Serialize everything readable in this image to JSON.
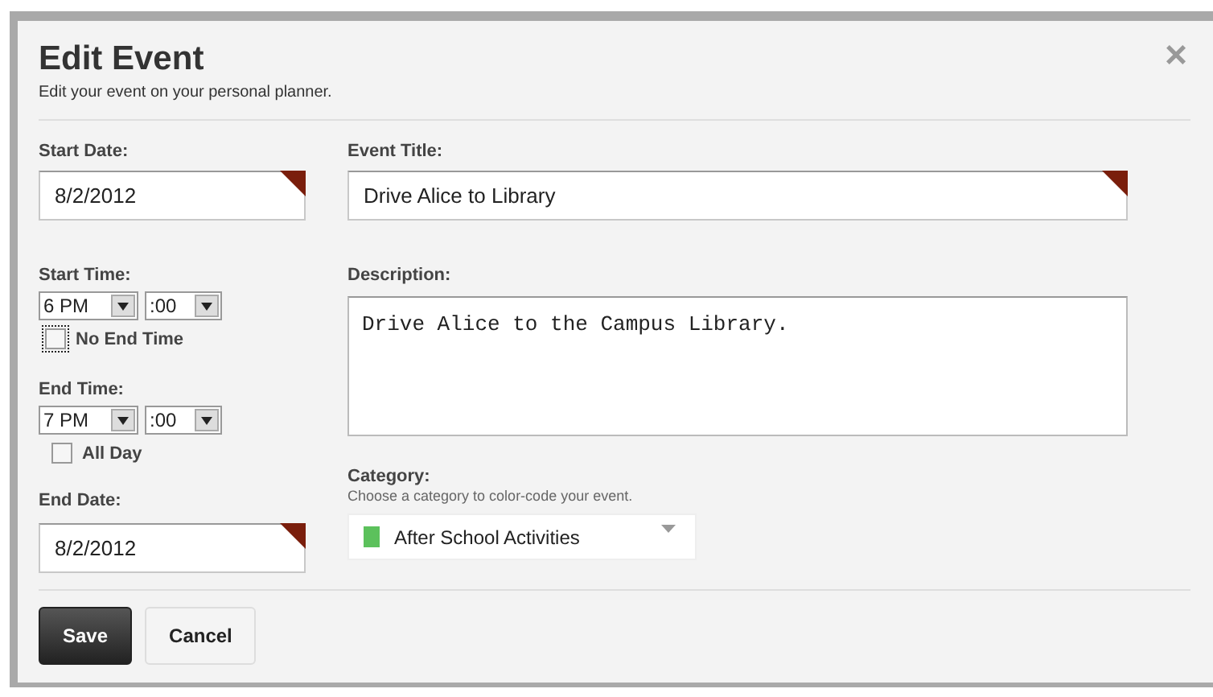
{
  "dialog": {
    "title": "Edit Event",
    "subtitle": "Edit your event on your personal planner.",
    "close": "×"
  },
  "start_date": {
    "label": "Start Date:",
    "value": "8/2/2012",
    "required": true
  },
  "start_time": {
    "label": "Start Time:",
    "hour": "6 PM",
    "minute": ":00"
  },
  "no_end_time": {
    "label": "No End Time",
    "checked": false,
    "focused": true
  },
  "end_time": {
    "label": "End Time:",
    "hour": "7 PM",
    "minute": ":00"
  },
  "all_day": {
    "label": "All Day",
    "checked": false,
    "focused": false
  },
  "end_date": {
    "label": "End Date:",
    "value": "8/2/2012",
    "required": true
  },
  "event_title": {
    "label": "Event Title:",
    "value": "Drive Alice to Library",
    "required": true
  },
  "description": {
    "label": "Description:",
    "value": "Drive Alice to the Campus Library."
  },
  "category": {
    "label": "Category:",
    "hint": "Choose a category to color-code your event.",
    "value": "After School Activities",
    "color": "#5cc15c"
  },
  "buttons": [
    {
      "label": "Save",
      "kind": "primary"
    },
    {
      "label": "Cancel",
      "kind": "secondary"
    }
  ]
}
